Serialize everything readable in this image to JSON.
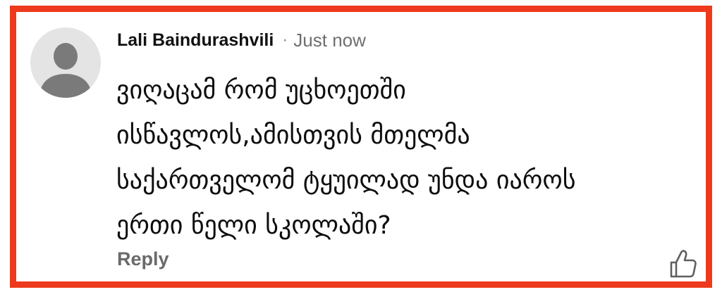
{
  "comment": {
    "author": "Lali Baindurashvili",
    "separator": "·",
    "timestamp": "Just now",
    "lines": [
      "ვიღაცამ რომ უცხოეთში",
      "ისწავლოს,ამისთვის მთელმა",
      "საქართველომ ტყუილად უნდა იაროს",
      "ერთი წელი სკოლაში?"
    ],
    "reply_label": "Reply"
  },
  "icons": {
    "avatar": "default-user-avatar",
    "like": "thumbs-up-outline-icon"
  },
  "colors": {
    "highlight_border": "#ee3a1c",
    "avatar_bg": "#e4e4e4",
    "avatar_figure": "#7a7a7a",
    "author_text": "#111111",
    "meta_text": "#6f6f6f",
    "reply_text": "#6a6a6a"
  }
}
